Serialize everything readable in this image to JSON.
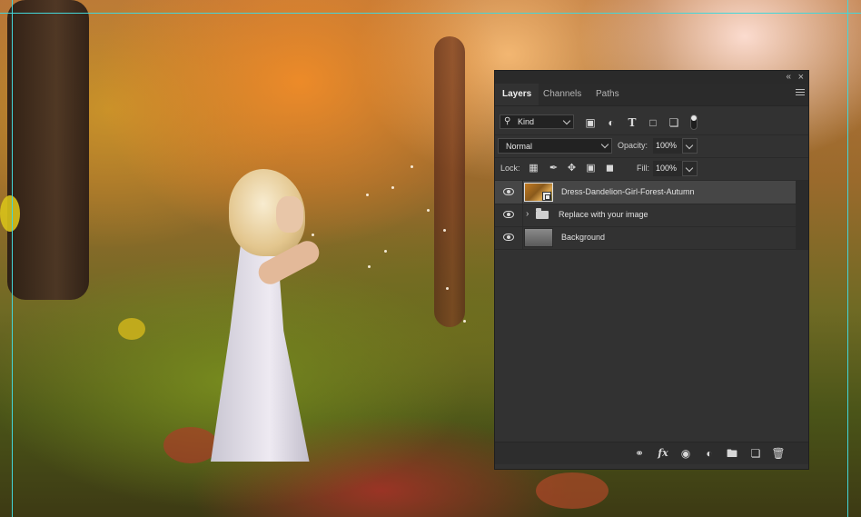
{
  "panel": {
    "tabs": [
      {
        "label": "Layers",
        "active": true
      },
      {
        "label": "Channels",
        "active": false
      },
      {
        "label": "Paths",
        "active": false
      }
    ],
    "filter": {
      "kind_label": "Kind"
    },
    "blend_mode": "Normal",
    "opacity_label": "Opacity:",
    "opacity_value": "100%",
    "lock_label": "Lock:",
    "fill_label": "Fill:",
    "fill_value": "100%",
    "layers": [
      {
        "name": "Dress-Dandelion-Girl-Forest-Autumn",
        "type": "smart-object",
        "visible": true,
        "selected": true
      },
      {
        "name": "Replace with your image",
        "type": "group",
        "visible": true,
        "selected": false
      },
      {
        "name": "Background",
        "type": "background",
        "visible": true,
        "selected": false
      }
    ]
  },
  "icons": {
    "filter": [
      "image-filter-icon",
      "adjustment-filter-icon",
      "type-filter-icon",
      "shape-filter-icon",
      "smart-object-filter-icon"
    ],
    "lock": [
      "lock-transparent-pixels-icon",
      "lock-image-pixels-icon",
      "lock-position-icon",
      "lock-artboard-icon",
      "lock-all-icon"
    ],
    "bottom": [
      "link-layers-icon",
      "fx-icon",
      "add-mask-icon",
      "new-adjustment-layer-icon",
      "new-group-icon",
      "new-layer-icon",
      "delete-layer-icon"
    ]
  },
  "colors": {
    "panel_bg": "#323232",
    "selected_row": "#464646",
    "guide": "#43d6d9"
  }
}
